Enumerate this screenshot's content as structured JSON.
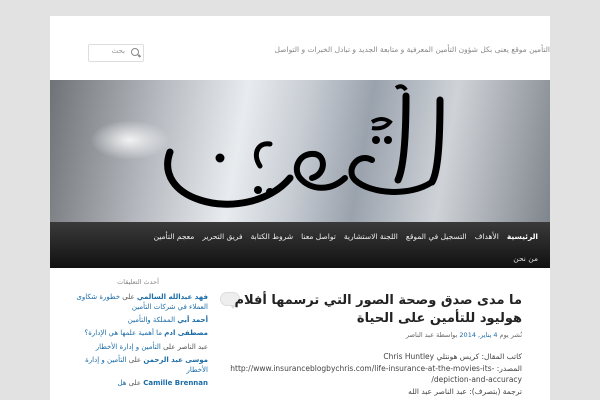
{
  "header": {
    "search_placeholder": "بحث",
    "tagline": "التأمين موقع يعنى بكل شؤون التأمين المعرفية و متابعة الجديد و تبادل الخبرات و التواصل"
  },
  "banner": {
    "logo_text": "التأمين"
  },
  "nav": {
    "items": [
      {
        "label": "الرئيسية",
        "active": true
      },
      {
        "label": "الأهداف"
      },
      {
        "label": "التسجيل في الموقع"
      },
      {
        "label": "اللجنة الاستشارية"
      },
      {
        "label": "تواصل معنا"
      },
      {
        "label": "شروط الكتابة"
      },
      {
        "label": "فريق التحرير"
      },
      {
        "label": "معجم التأمين"
      }
    ],
    "row2": "من نحن"
  },
  "sidebar": {
    "heading": "أحدث التعليقات",
    "comments": [
      {
        "author": "فهد عبدالله السالمي",
        "on": "على",
        "post": "خطورة شكاوى العملاء في شركات التأمين"
      },
      {
        "author": "أحمد أبي",
        "on": "",
        "post": "المملكة والتأمين"
      },
      {
        "author": "مصطفى ادم",
        "on": "",
        "post": "ما أهمية علمها هي الإدارة؟"
      },
      {
        "author": "عبد الناصر",
        "on": "على",
        "post": "التأمين و إدارة الأخطار"
      },
      {
        "author": "موسى عبد الرحمن",
        "on": "على",
        "post": "التأمين و إدارة الأخطار"
      },
      {
        "author": "Camille Brennan",
        "on": "على",
        "post": "هل"
      }
    ]
  },
  "article": {
    "title": "ما مدى صدق وصحة الصور التي ترسمها أفلام هوليود للتأمين على الحياة",
    "date": "4 يناير, 2014",
    "meta_rest": "بواسطة عبد الناصر",
    "meta_by": "نُشر يوم",
    "lines": [
      "كاتب المقال: كريس هونتلي Chris Huntley",
      "المصدر: http://www.insuranceblogbychris.com/life-insurance-at-the-movies-its-depiction-and-accuracy/",
      "ترجمة (بتصرف): عبد الناصر عبد الله"
    ]
  }
}
